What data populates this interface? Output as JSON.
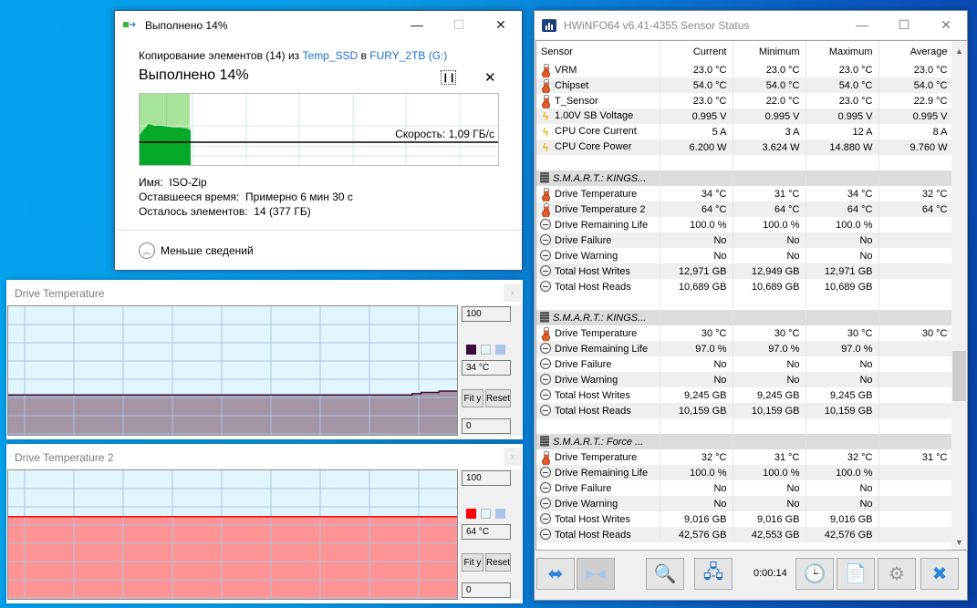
{
  "copy_dialog": {
    "title": "Выполнено 14%",
    "description_prefix": "Копирование элементов (14) из ",
    "source_link": "Temp_SSD",
    "description_mid": " в ",
    "dest_link": "FURY_2TB (G:)",
    "percent_label": "Выполнено 14%",
    "progress_percent": 14,
    "speed_label": "Скорость: 1,09 ГБ/с",
    "pause_icon": "pause-icon",
    "cancel_icon": "close-icon",
    "name_label": "Имя:",
    "name_value": "ISO-Zip",
    "time_left_label": "Оставшееся время:",
    "time_left_value": "Примерно 6 мин 30 с",
    "items_left_label": "Осталось элементов:",
    "items_left_value": "14 (377 ГБ)",
    "less_details": "Меньше сведений",
    "caption": {
      "minimize": "—",
      "maximize": "☐",
      "close": "✕"
    }
  },
  "graph_windows": [
    {
      "title": "Drive Temperature",
      "max_value": "100",
      "current_value": "34 °C",
      "min_value": "0",
      "fit_label": "Fit y",
      "reset_label": "Reset",
      "close_label": "x",
      "line_color": "#3d0a3d",
      "fill_color": "#a395a3",
      "background_color": "#e0f6fc",
      "grid_color": "#aac4e8"
    },
    {
      "title": "Drive Temperature 2",
      "max_value": "100",
      "current_value": "64 °C",
      "min_value": "0",
      "fit_label": "Fit y",
      "reset_label": "Reset",
      "close_label": "x",
      "line_color": "#ff0000",
      "fill_color": "#fd9393",
      "background_color": "#e0f6fc",
      "grid_color": "#aac4e8"
    }
  ],
  "hwinfo": {
    "title": "HWiNFO64 v6.41-4355 Sensor Status",
    "caption": {
      "minimize": "—",
      "maximize": "☐",
      "close": "✕"
    },
    "columns": [
      "Sensor",
      "Current",
      "Minimum",
      "Maximum",
      "Average"
    ],
    "rows": [
      {
        "type": "data",
        "icon": "thermometer-icon",
        "name": "VRM",
        "current": "23.0 °C",
        "min": "23.0 °C",
        "max": "23.0 °C",
        "avg": "23.0 °C"
      },
      {
        "type": "data",
        "icon": "thermometer-icon",
        "name": "Chipset",
        "current": "54.0 °C",
        "min": "54.0 °C",
        "max": "54.0 °C",
        "avg": "54.0 °C"
      },
      {
        "type": "data",
        "icon": "thermometer-icon",
        "name": "T_Sensor",
        "current": "23.0 °C",
        "min": "22.0 °C",
        "max": "23.0 °C",
        "avg": "22.9 °C"
      },
      {
        "type": "data",
        "icon": "lightning-icon",
        "name": "1.00V SB Voltage",
        "current": "0.995 V",
        "min": "0.995 V",
        "max": "0.995 V",
        "avg": "0.995 V"
      },
      {
        "type": "data",
        "icon": "lightning-icon",
        "name": "CPU Core Current",
        "current": "5 A",
        "min": "3 A",
        "max": "12 A",
        "avg": "8 A"
      },
      {
        "type": "data",
        "icon": "lightning-icon",
        "name": "CPU Core Power",
        "current": "6.200 W",
        "min": "3.624 W",
        "max": "14.880 W",
        "avg": "9.760 W"
      },
      {
        "type": "blank"
      },
      {
        "type": "group",
        "icon": "chip-icon",
        "name": "S.M.A.R.T.: KINGS..."
      },
      {
        "type": "data",
        "icon": "thermometer-icon",
        "name": "Drive Temperature",
        "current": "34 °C",
        "min": "31 °C",
        "max": "34 °C",
        "avg": "32 °C"
      },
      {
        "type": "data",
        "icon": "thermometer-icon",
        "name": "Drive Temperature 2",
        "current": "64 °C",
        "min": "64 °C",
        "max": "64 °C",
        "avg": "64 °C"
      },
      {
        "type": "data",
        "icon": "gauge-icon",
        "name": "Drive Remaining Life",
        "current": "100.0 %",
        "min": "100.0 %",
        "max": "100.0 %",
        "avg": ""
      },
      {
        "type": "data",
        "icon": "gauge-icon",
        "name": "Drive Failure",
        "current": "No",
        "min": "No",
        "max": "No",
        "avg": ""
      },
      {
        "type": "data",
        "icon": "gauge-icon",
        "name": "Drive Warning",
        "current": "No",
        "min": "No",
        "max": "No",
        "avg": ""
      },
      {
        "type": "data",
        "icon": "gauge-icon",
        "name": "Total Host Writes",
        "current": "12,971 GB",
        "min": "12,949 GB",
        "max": "12,971 GB",
        "avg": ""
      },
      {
        "type": "data",
        "icon": "gauge-icon",
        "name": "Total Host Reads",
        "current": "10,689 GB",
        "min": "10,689 GB",
        "max": "10,689 GB",
        "avg": ""
      },
      {
        "type": "blank"
      },
      {
        "type": "group",
        "icon": "chip-icon",
        "name": "S.M.A.R.T.: KINGS..."
      },
      {
        "type": "data",
        "icon": "thermometer-icon",
        "name": "Drive Temperature",
        "current": "30 °C",
        "min": "30 °C",
        "max": "30 °C",
        "avg": "30 °C"
      },
      {
        "type": "data",
        "icon": "gauge-icon",
        "name": "Drive Remaining Life",
        "current": "97.0 %",
        "min": "97.0 %",
        "max": "97.0 %",
        "avg": ""
      },
      {
        "type": "data",
        "icon": "gauge-icon",
        "name": "Drive Failure",
        "current": "No",
        "min": "No",
        "max": "No",
        "avg": ""
      },
      {
        "type": "data",
        "icon": "gauge-icon",
        "name": "Drive Warning",
        "current": "No",
        "min": "No",
        "max": "No",
        "avg": ""
      },
      {
        "type": "data",
        "icon": "gauge-icon",
        "name": "Total Host Writes",
        "current": "9,245 GB",
        "min": "9,245 GB",
        "max": "9,245 GB",
        "avg": ""
      },
      {
        "type": "data",
        "icon": "gauge-icon",
        "name": "Total Host Reads",
        "current": "10,159 GB",
        "min": "10,159 GB",
        "max": "10,159 GB",
        "avg": ""
      },
      {
        "type": "blank"
      },
      {
        "type": "group",
        "icon": "chip-icon",
        "name": "S.M.A.R.T.: Force ..."
      },
      {
        "type": "data",
        "icon": "thermometer-icon",
        "name": "Drive Temperature",
        "current": "32 °C",
        "min": "31 °C",
        "max": "32 °C",
        "avg": "31 °C"
      },
      {
        "type": "data",
        "icon": "gauge-icon",
        "name": "Drive Remaining Life",
        "current": "100.0 %",
        "min": "100.0 %",
        "max": "100.0 %",
        "avg": ""
      },
      {
        "type": "data",
        "icon": "gauge-icon",
        "name": "Drive Failure",
        "current": "No",
        "min": "No",
        "max": "No",
        "avg": ""
      },
      {
        "type": "data",
        "icon": "gauge-icon",
        "name": "Drive Warning",
        "current": "No",
        "min": "No",
        "max": "No",
        "avg": ""
      },
      {
        "type": "data",
        "icon": "gauge-icon",
        "name": "Total Host Writes",
        "current": "9,016 GB",
        "min": "9,016 GB",
        "max": "9,016 GB",
        "avg": ""
      },
      {
        "type": "data",
        "icon": "gauge-icon",
        "name": "Total Host Reads",
        "current": "42,576 GB",
        "min": "42,553 GB",
        "max": "42,576 GB",
        "avg": ""
      }
    ],
    "toolbar": {
      "timer": "0:00:14",
      "buttons": [
        {
          "name": "expand-columns-button",
          "icon": "arrows-out-icon",
          "glyph": "⬌"
        },
        {
          "name": "collapse-columns-button",
          "icon": "arrows-in-icon",
          "glyph": "⇥⇤",
          "disabled": true
        },
        {
          "name": "sensor-search-button",
          "icon": "magnifier-monitor-icon",
          "glyph": "🔍"
        },
        {
          "name": "network-button",
          "icon": "network-computers-icon",
          "glyph": "🖧"
        },
        {
          "name": "reset-clock-button",
          "icon": "clock-icon",
          "glyph": "🕒"
        },
        {
          "name": "logging-button",
          "icon": "add-log-icon",
          "glyph": "📄"
        },
        {
          "name": "settings-button",
          "icon": "gear-icon",
          "glyph": "⚙"
        },
        {
          "name": "close-sensors-button",
          "icon": "close-x-icon",
          "glyph": "✖"
        }
      ]
    }
  },
  "chart_data": [
    {
      "type": "area",
      "title": "Drive Temperature",
      "ylim": [
        0,
        100
      ],
      "unit": "°C",
      "values": [
        31,
        31,
        31,
        31,
        31,
        31,
        31,
        31,
        31,
        31,
        31,
        31,
        31,
        31,
        31,
        31,
        31,
        31,
        31,
        31,
        31,
        31,
        31,
        31,
        31,
        31,
        31,
        31,
        31,
        31,
        31,
        31,
        31,
        31,
        31,
        31,
        31,
        31,
        31,
        31,
        31,
        31,
        31,
        31,
        31,
        31,
        31,
        31,
        31,
        31,
        31,
        31,
        31,
        31,
        31,
        31,
        31,
        31,
        31,
        31,
        31,
        31,
        31,
        31,
        31,
        31,
        31,
        31,
        31,
        31,
        31,
        31,
        31,
        31,
        31,
        31,
        31,
        31,
        31,
        31,
        31,
        31,
        31,
        31,
        31,
        31,
        31,
        31,
        31,
        31,
        32,
        32,
        33,
        33,
        33,
        33,
        34,
        34,
        34,
        34
      ]
    },
    {
      "type": "area",
      "title": "Drive Temperature 2",
      "ylim": [
        0,
        100
      ],
      "unit": "°C",
      "values": [
        64,
        64,
        64,
        64,
        64,
        64,
        64,
        64,
        64,
        64,
        64,
        64,
        64,
        64,
        64,
        64,
        64,
        64,
        64,
        64
      ]
    },
    {
      "type": "area",
      "title": "Copy speed",
      "progress_percent": 14,
      "current_speed": "1,09 ГБ/с"
    }
  ]
}
